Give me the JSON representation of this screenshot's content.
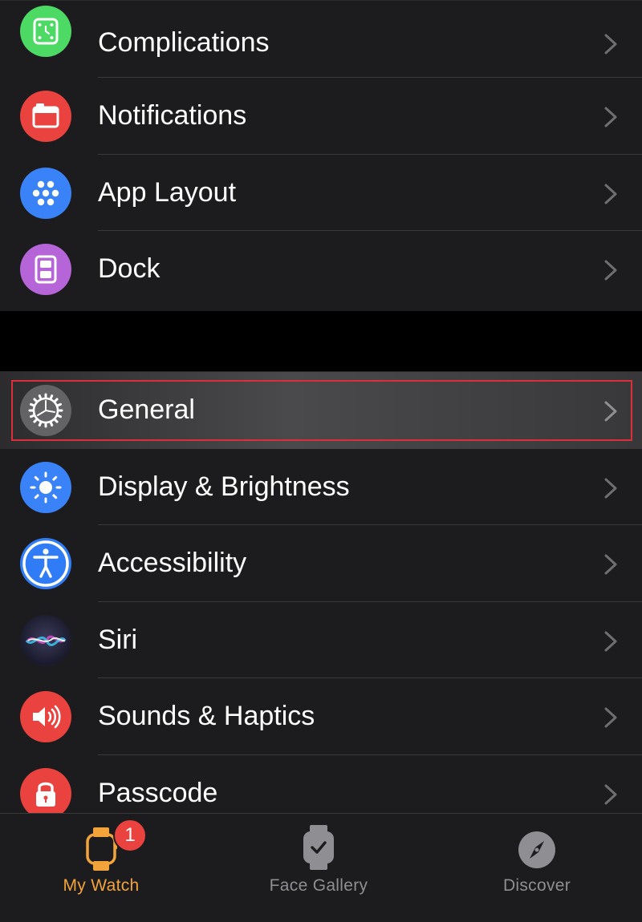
{
  "settings_top": [
    {
      "label": "Complications",
      "icon": "complications-icon",
      "color": "#4cd964"
    },
    {
      "label": "Notifications",
      "icon": "notifications-icon",
      "color": "#e9423f"
    },
    {
      "label": "App Layout",
      "icon": "app-layout-icon",
      "color": "#3a82f7"
    },
    {
      "label": "Dock",
      "icon": "dock-icon",
      "color": "#b565d8"
    }
  ],
  "settings_bottom": [
    {
      "label": "General",
      "icon": "gear-icon",
      "color": "#8e8e93",
      "selected": true
    },
    {
      "label": "Display & Brightness",
      "icon": "brightness-icon",
      "color": "#3a82f7"
    },
    {
      "label": "Accessibility",
      "icon": "accessibility-icon",
      "color": "#2f7cf6"
    },
    {
      "label": "Siri",
      "icon": "siri-icon",
      "color": "#2a2a4a"
    },
    {
      "label": "Sounds & Haptics",
      "icon": "speaker-icon",
      "color": "#e9423f"
    },
    {
      "label": "Passcode",
      "icon": "lock-icon",
      "color": "#e9423f"
    }
  ],
  "tabbar": {
    "tabs": [
      {
        "label": "My Watch",
        "icon": "watch-icon",
        "active": true,
        "badge": "1"
      },
      {
        "label": "Face Gallery",
        "icon": "face-gallery-icon",
        "active": false
      },
      {
        "label": "Discover",
        "icon": "compass-icon",
        "active": false
      }
    ],
    "active_color": "#f2a33a",
    "inactive_color": "#8e8e93"
  }
}
